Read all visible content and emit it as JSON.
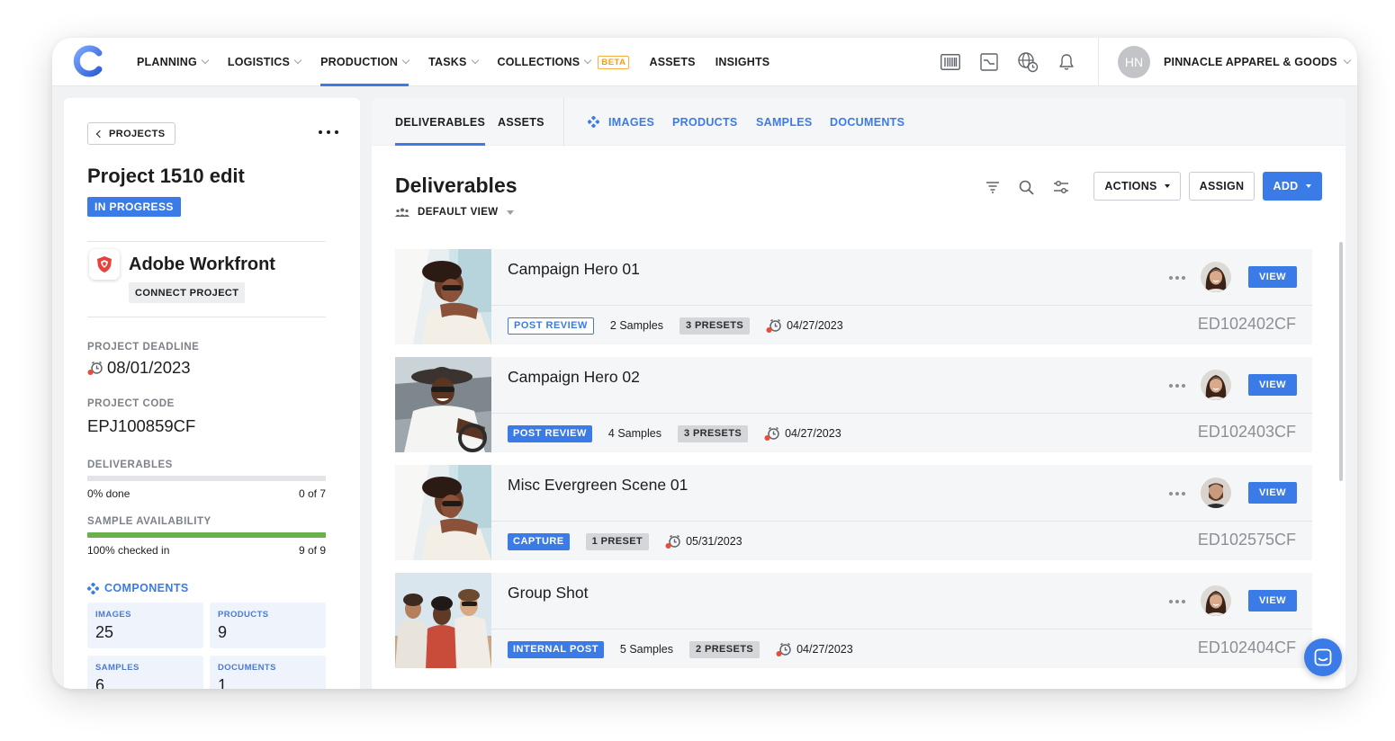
{
  "nav": {
    "items": [
      {
        "label": "PLANNING",
        "has_menu": true,
        "active": false
      },
      {
        "label": "LOGISTICS",
        "has_menu": true,
        "active": false
      },
      {
        "label": "PRODUCTION",
        "has_menu": true,
        "active": true
      },
      {
        "label": "TASKS",
        "has_menu": true,
        "active": false
      },
      {
        "label": "COLLECTIONS",
        "has_menu": true,
        "active": false
      },
      {
        "label": "ASSETS",
        "has_menu": false,
        "active": false
      },
      {
        "label": "INSIGHTS",
        "has_menu": false,
        "active": false
      }
    ],
    "beta_label": "BETA",
    "icons": [
      "barcode-icon",
      "chart-icon",
      "globe-clock-icon",
      "bell-icon"
    ],
    "account_initials": "HN",
    "account_name": "PINNACLE APPAREL & GOODS"
  },
  "left": {
    "back_label": "PROJECTS",
    "project_title": "Project 1510 edit",
    "status": "IN PROGRESS",
    "integration_name": "Adobe Workfront",
    "connect_label": "CONNECT PROJECT",
    "deadline_label": "PROJECT DEADLINE",
    "deadline_value": "08/01/2023",
    "code_label": "PROJECT CODE",
    "code_value": "EPJ100859CF",
    "deliverables_label": "DELIVERABLES",
    "deliverables_progress": 0,
    "deliverables_done": "0% done",
    "deliverables_count": "0 of 7",
    "availability_label": "SAMPLE AVAILABILITY",
    "availability_progress": 100,
    "availability_text": "100% checked in",
    "availability_count": "9 of 9",
    "components_label": "COMPONENTS",
    "tiles": [
      {
        "label": "IMAGES",
        "value": "25"
      },
      {
        "label": "PRODUCTS",
        "value": "9"
      },
      {
        "label": "SAMPLES",
        "value": "6"
      },
      {
        "label": "DOCUMENTS",
        "value": "1"
      }
    ]
  },
  "tabs": {
    "primary": [
      "DELIVERABLES",
      "ASSETS"
    ],
    "secondary": [
      "IMAGES",
      "PRODUCTS",
      "SAMPLES",
      "DOCUMENTS"
    ]
  },
  "main": {
    "title": "Deliverables",
    "view_label": "DEFAULT VIEW",
    "actions_label": "ACTIONS",
    "assign_label": "ASSIGN",
    "add_label": "ADD"
  },
  "rows": [
    {
      "title": "Campaign Hero 01",
      "status": "POST REVIEW",
      "status_style": "outline",
      "samples": "2 Samples",
      "presets": "3 PRESETS",
      "date": "04/27/2023",
      "code": "ED102402CF",
      "view": "VIEW",
      "avatar": "woman"
    },
    {
      "title": "Campaign Hero 02",
      "status": "POST REVIEW",
      "status_style": "filled",
      "samples": "4 Samples",
      "presets": "3 PRESETS",
      "date": "04/27/2023",
      "code": "ED102403CF",
      "view": "VIEW",
      "avatar": "woman"
    },
    {
      "title": "Misc Evergreen Scene 01",
      "status": "CAPTURE",
      "status_style": "filled",
      "samples": "",
      "presets": "1 PRESET",
      "date": "05/31/2023",
      "code": "ED102575CF",
      "view": "VIEW",
      "avatar": "man"
    },
    {
      "title": "Group Shot",
      "status": "INTERNAL POST",
      "status_style": "filled",
      "samples": "5 Samples",
      "presets": "2 PRESETS",
      "date": "04/27/2023",
      "code": "ED102404CF",
      "view": "VIEW",
      "avatar": "woman"
    }
  ],
  "colors": {
    "accent": "#3b7be8",
    "success": "#6ab04c",
    "alert": "#e74c3c",
    "beta": "#f39c12"
  }
}
